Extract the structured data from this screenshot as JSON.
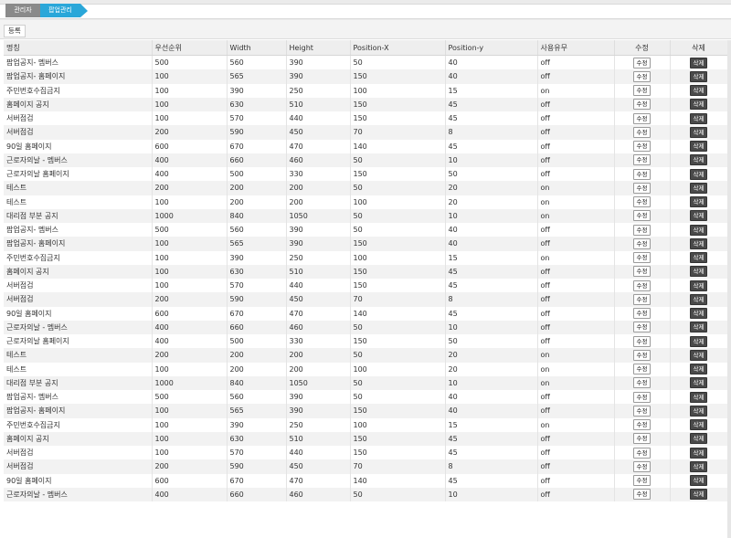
{
  "breadcrumb": {
    "admin": "관리자",
    "popup": "팝업관리"
  },
  "toolbar": {
    "register_label": "등록"
  },
  "columns": [
    "명칭",
    "우선순위",
    "Width",
    "Height",
    "Position-X",
    "Position-y",
    "사용유무",
    "수정",
    "삭제"
  ],
  "buttons": {
    "edit": "수정",
    "delete": "삭제"
  },
  "rows": [
    [
      "팝업공지- 멤버스",
      "500",
      "560",
      "390",
      "50",
      "40",
      "off"
    ],
    [
      "팝업공지- 홈페이지",
      "100",
      "565",
      "390",
      "150",
      "40",
      "off"
    ],
    [
      "주민번호수집금지",
      "100",
      "390",
      "250",
      "100",
      "15",
      "on"
    ],
    [
      "홈페이지 공지",
      "100",
      "630",
      "510",
      "150",
      "45",
      "off"
    ],
    [
      "서버점검",
      "100",
      "570",
      "440",
      "150",
      "45",
      "off"
    ],
    [
      "서버점검",
      "200",
      "590",
      "450",
      "70",
      "8",
      "off"
    ],
    [
      "90일 홈페이지",
      "600",
      "670",
      "470",
      "140",
      "45",
      "off"
    ],
    [
      "근로자의날 - 멤버스",
      "400",
      "660",
      "460",
      "50",
      "10",
      "off"
    ],
    [
      "근로자의날 홈페이지",
      "400",
      "500",
      "330",
      "150",
      "50",
      "off"
    ],
    [
      "테스트",
      "200",
      "200",
      "200",
      "50",
      "20",
      "on"
    ],
    [
      "테스트",
      "100",
      "200",
      "200",
      "100",
      "20",
      "on"
    ],
    [
      "대리점 부분 공지",
      "1000",
      "840",
      "1050",
      "50",
      "10",
      "on"
    ],
    [
      "팝업공지- 멤버스",
      "500",
      "560",
      "390",
      "50",
      "40",
      "off"
    ],
    [
      "팝업공지- 홈페이지",
      "100",
      "565",
      "390",
      "150",
      "40",
      "off"
    ],
    [
      "주민번호수집금지",
      "100",
      "390",
      "250",
      "100",
      "15",
      "on"
    ],
    [
      "홈페이지 공지",
      "100",
      "630",
      "510",
      "150",
      "45",
      "off"
    ],
    [
      "서버점검",
      "100",
      "570",
      "440",
      "150",
      "45",
      "off"
    ],
    [
      "서버점검",
      "200",
      "590",
      "450",
      "70",
      "8",
      "off"
    ],
    [
      "90일 홈페이지",
      "600",
      "670",
      "470",
      "140",
      "45",
      "off"
    ],
    [
      "근로자의날 - 멤버스",
      "400",
      "660",
      "460",
      "50",
      "10",
      "off"
    ],
    [
      "근로자의날 홈페이지",
      "400",
      "500",
      "330",
      "150",
      "50",
      "off"
    ],
    [
      "테스트",
      "200",
      "200",
      "200",
      "50",
      "20",
      "on"
    ],
    [
      "테스트",
      "100",
      "200",
      "200",
      "100",
      "20",
      "on"
    ],
    [
      "대리점 부분 공지",
      "1000",
      "840",
      "1050",
      "50",
      "10",
      "on"
    ],
    [
      "팝업공지- 멤버스",
      "500",
      "560",
      "390",
      "50",
      "40",
      "off"
    ],
    [
      "팝업공지- 홈페이지",
      "100",
      "565",
      "390",
      "150",
      "40",
      "off"
    ],
    [
      "주민번호수집금지",
      "100",
      "390",
      "250",
      "100",
      "15",
      "on"
    ],
    [
      "홈페이지 공지",
      "100",
      "630",
      "510",
      "150",
      "45",
      "off"
    ],
    [
      "서버점검",
      "100",
      "570",
      "440",
      "150",
      "45",
      "off"
    ],
    [
      "서버점검",
      "200",
      "590",
      "450",
      "70",
      "8",
      "off"
    ],
    [
      "90일 홈페이지",
      "600",
      "670",
      "470",
      "140",
      "45",
      "off"
    ],
    [
      "근로자의날 - 멤버스",
      "400",
      "660",
      "460",
      "50",
      "10",
      "off"
    ]
  ]
}
